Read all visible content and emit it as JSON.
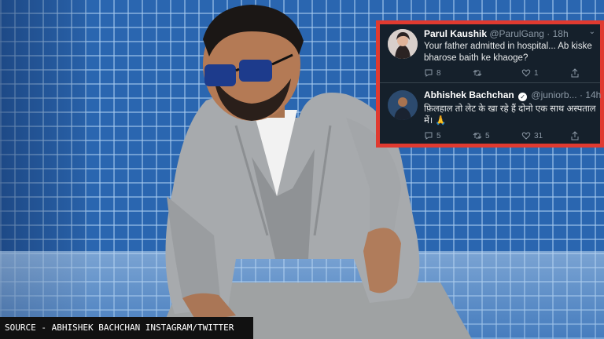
{
  "tweets": [
    {
      "name": "Parul Kaushik",
      "handle": "@ParulGang",
      "time": "18h",
      "text": "Your father admitted in hospital... Ab kiske bharose baith ke khaoge?",
      "replies": "8",
      "retweets": "",
      "likes": "1"
    },
    {
      "name": "Abhishek Bachchan",
      "handle": "@juniorb...",
      "time": "14h",
      "text": "फ़िलहाल तो लेट के खा रहे हैं दोनो एक साथ अस्पताल में। 🙏",
      "replies": "5",
      "retweets": "5",
      "likes": "31"
    }
  ],
  "caption": "SOURCE - ABHISHEK BACHCHAN INSTAGRAM/TWITTER",
  "colors": {
    "card_bg": "#15202b",
    "card_border": "#e03a30",
    "tiles": "#2a66b0"
  }
}
